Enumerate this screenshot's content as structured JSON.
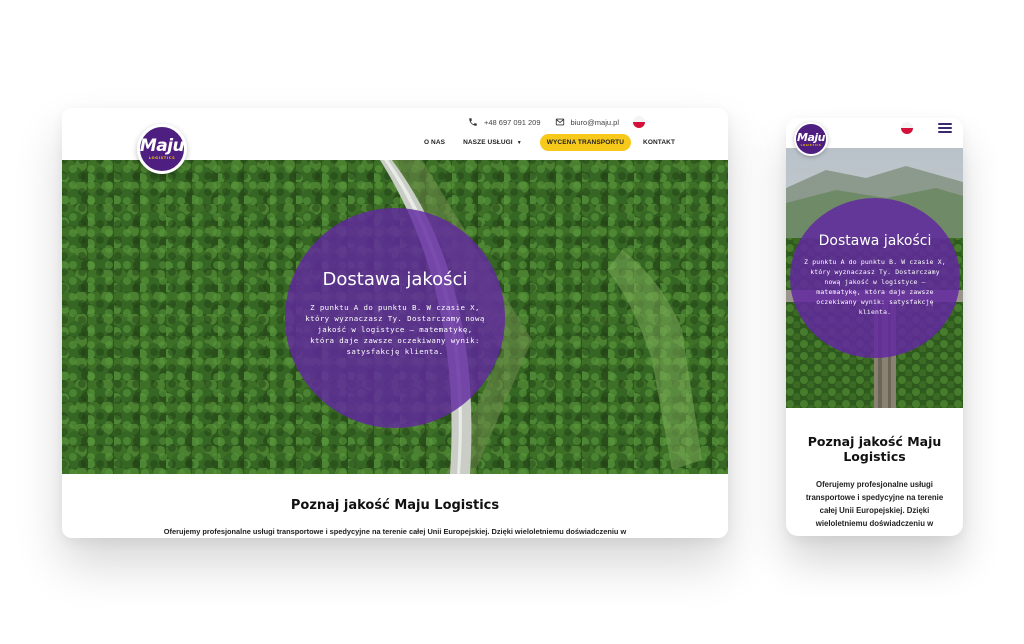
{
  "brand": {
    "logo_word": "Maju",
    "logo_sub": "LOGISTICS"
  },
  "desktop": {
    "contact": {
      "phone": "+48 697 091 209",
      "email": "biuro@maju.pl"
    },
    "nav": [
      {
        "label": "O NAS"
      },
      {
        "label": "NASZE USŁUGI",
        "has_dropdown": true
      },
      {
        "label": "WYCENA TRANSPORTU",
        "highlighted": true
      },
      {
        "label": "KONTAKT"
      }
    ],
    "hero": {
      "title": "Dostawa jakości",
      "text": "Z punktu A do punktu B. W czasie X, który wyznaczasz Ty. Dostarczamy nową jakość w logistyce — matematykę, która daje zawsze oczekiwany wynik: satysfakcję klienta."
    },
    "section": {
      "title": "Poznaj jakość Maju Logistics",
      "text": "Oferujemy profesjonalne usługi transportowe i spedycyjne na terenie całej Unii Europejskiej. Dzięki wieloletniemu doświadczeniu w"
    }
  },
  "mobile": {
    "hero": {
      "title": "Dostawa jakości",
      "text": "Z punktu A do punktu B. W czasie X, który wyznaczasz Ty. Dostarczamy nową jakość w logistyce — matematykę, która daje zawsze oczekiwany wynik: satysfakcję klienta."
    },
    "section": {
      "title": "Poznaj jakość Maju Logistics",
      "text": "Oferujemy profesjonalne usługi transportowe i spedycyjne na terenie całej Unii Europejskiej. Dzięki wieloletniemu doświadczeniu w"
    }
  },
  "colors": {
    "brand_purple": "#4e1f80",
    "hero_overlay": "#6228a0",
    "cta_yellow": "#f6c91a",
    "flag_red": "#dc143c"
  },
  "icons": {
    "phone": "phone-icon",
    "email": "envelope-icon",
    "language": "polish-flag-icon",
    "menu": "hamburger-menu-icon"
  }
}
